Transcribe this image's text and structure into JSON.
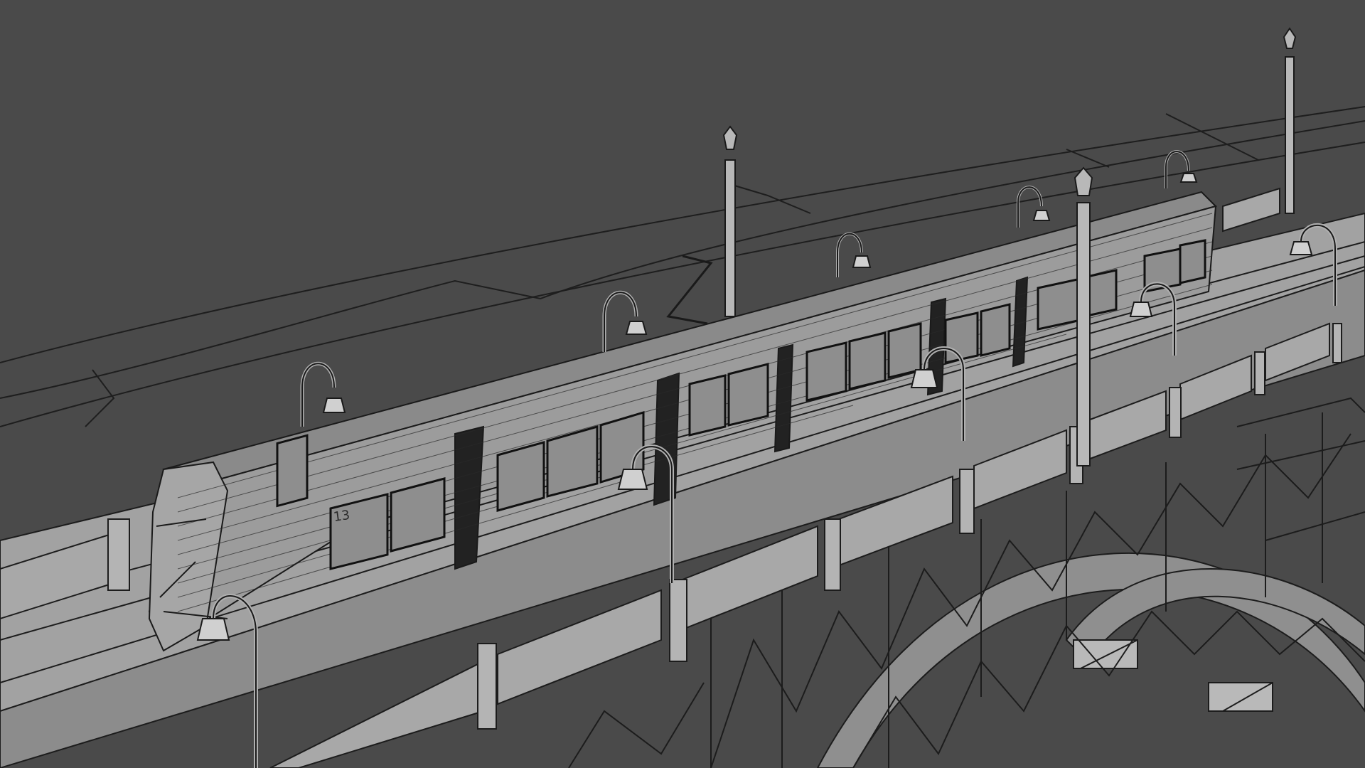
{
  "scene": {
    "description_visible_text": "",
    "tram": {
      "number_label": "13"
    },
    "render_style": {
      "background": "#4a4a4a",
      "surface": "#9a9a9a",
      "surface_light": "#b4b4b4",
      "surface_dark": "#7c7c7c",
      "wire": "#1c1c1c"
    }
  }
}
